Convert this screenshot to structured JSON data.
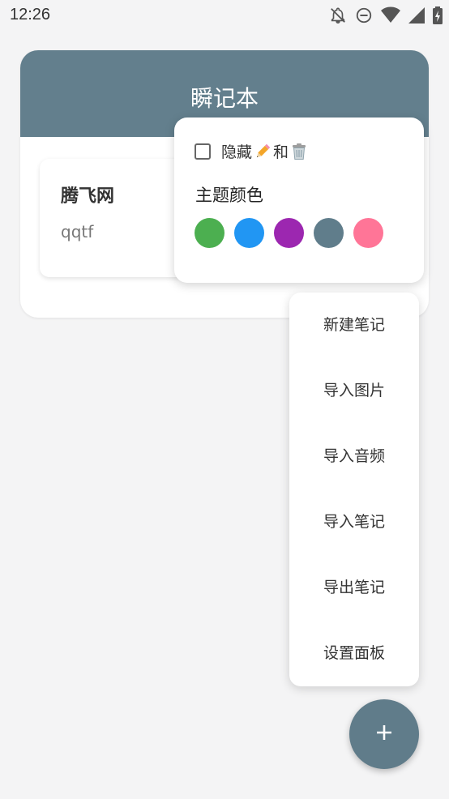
{
  "status_bar": {
    "time": "12:26",
    "icons": [
      "notifications-off-icon",
      "do-not-disturb-icon",
      "wifi-icon",
      "signal-icon",
      "battery-charging-icon"
    ]
  },
  "app": {
    "title": "瞬记本",
    "accent_color": "#637f8d"
  },
  "note": {
    "title": "腾飞网",
    "body": "qqtf"
  },
  "settings_popup": {
    "hide_label_prefix": "隐藏",
    "hide_label_middle": "和",
    "hide_icons": [
      "pencil-icon",
      "trash-icon"
    ],
    "hide_checked": false,
    "theme_label": "主题颜色",
    "theme_colors": [
      "#4caf50",
      "#2196f3",
      "#9c27b0",
      "#607d8b",
      "#ff7597"
    ]
  },
  "menu": {
    "items": [
      "新建笔记",
      "导入图片",
      "导入音频",
      "导入笔记",
      "导出笔记",
      "设置面板"
    ]
  },
  "fab": {
    "icon": "plus-icon",
    "label": "+"
  }
}
